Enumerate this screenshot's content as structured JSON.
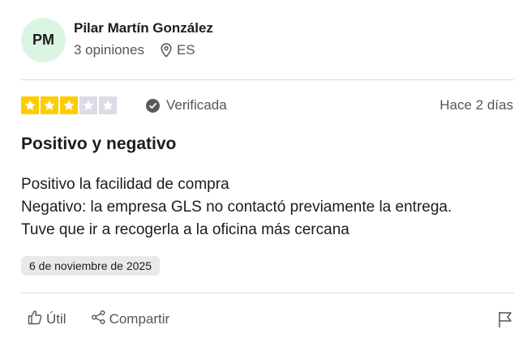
{
  "reviewer": {
    "initials": "PM",
    "name": "Pilar Martín González",
    "reviews_count": "3 opiniones",
    "country": "ES"
  },
  "review": {
    "rating": 3,
    "rating_max": 5,
    "verified_label": "Verificada",
    "relative_date": "Hace 2 días",
    "title": "Positivo y negativo",
    "body_lines": [
      "Positivo la facilidad de compra",
      "Negativo: la empresa GLS no contactó previamente la entrega.",
      "Tuve que ir a recogerla a la oficina más cercana"
    ],
    "experience_date": "6 de noviembre de 2025"
  },
  "actions": {
    "useful_label": "Útil",
    "share_label": "Compartir"
  },
  "colors": {
    "star_on": "#ffcc00",
    "star_off": "#dcdce6",
    "avatar_bg": "#dcf5e3"
  },
  "icons": [
    "location-pin-icon",
    "star-icon",
    "verified-check-icon",
    "thumbs-up-icon",
    "share-icon",
    "flag-icon"
  ]
}
